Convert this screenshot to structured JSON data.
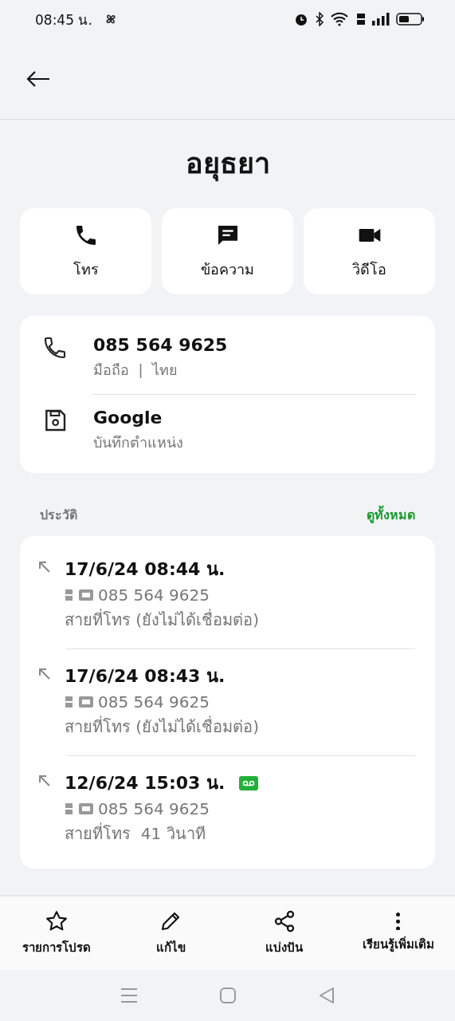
{
  "status_bar": {
    "time": "08:45 น."
  },
  "contact": {
    "name": "อยุธยา"
  },
  "actions": [
    {
      "kind": "call",
      "label": "โทร"
    },
    {
      "kind": "message",
      "label": "ข้อความ"
    },
    {
      "kind": "video",
      "label": "วิดีโอ"
    }
  ],
  "info": [
    {
      "kind": "phone",
      "title": "085 564 9625",
      "subtitle": "มือถือ  |  ไทย"
    },
    {
      "kind": "save",
      "title": "Google",
      "subtitle": "บันทึกตำแหน่ง"
    }
  ],
  "history": {
    "label": "ประวัติ",
    "view_all": "ดูทั้งหมด",
    "entries": [
      {
        "time": "17/6/24 08:44 น.",
        "number": "085 564 9625",
        "detail": "สายที่โทร (ยังไม่ได้เชื่อมต่อ)",
        "voicemail": false
      },
      {
        "time": "17/6/24 08:43 น.",
        "number": "085 564 9625",
        "detail": "สายที่โทร (ยังไม่ได้เชื่อมต่อ)",
        "voicemail": false
      },
      {
        "time": "12/6/24 15:03 น.",
        "number": "085 564 9625",
        "detail": "สายที่โทร  41 วินาที",
        "voicemail": true
      }
    ]
  },
  "bottom_actions": [
    {
      "kind": "favorite",
      "label": "รายการโปรด"
    },
    {
      "kind": "edit",
      "label": "แก้ไข"
    },
    {
      "kind": "share",
      "label": "แบ่งปัน"
    },
    {
      "kind": "more",
      "label": "เรียนรู้เพิ่มเติม"
    }
  ]
}
